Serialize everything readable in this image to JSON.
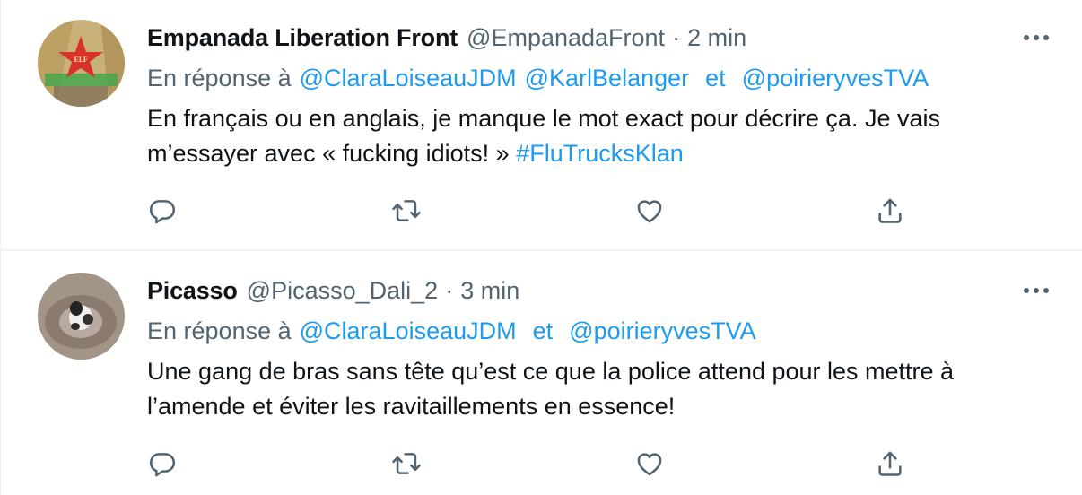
{
  "tweets": [
    {
      "author": {
        "name": "Empanada Liberation Front",
        "handle": "@EmpanadaFront",
        "time": "2 min",
        "avatar_text": "ELF"
      },
      "reply_prefix": "En réponse à",
      "mentions": [
        "@ClaraLoiseauJDM",
        "@KarlBelanger",
        "@poirieryvesTVA"
      ],
      "joiner": "et",
      "text": "En français ou en anglais, je manque le mot exact pour décrire ça. Je vais m’essayer avec « fucking idiots! »",
      "hashtag": "#FluTrucksKlan"
    },
    {
      "author": {
        "name": "Picasso",
        "handle": "@Picasso_Dali_2",
        "time": "3 min"
      },
      "reply_prefix": "En réponse à",
      "mentions": [
        "@ClaraLoiseauJDM",
        "@poirieryvesTVA"
      ],
      "joiner": "et",
      "text": "Une gang de bras sans tête qu’est ce que la police attend pour les mettre à l’amende et éviter les ravitaillements en essence!"
    }
  ],
  "separator_dot": "·",
  "icons": {
    "more": "more-icon",
    "reply": "reply-icon",
    "retweet": "retweet-icon",
    "like": "like-icon",
    "share": "share-icon"
  },
  "colors": {
    "link": "#1d9bf0",
    "secondary_text": "#536471",
    "primary_text": "#0f1419",
    "divider": "#eff3f4"
  }
}
